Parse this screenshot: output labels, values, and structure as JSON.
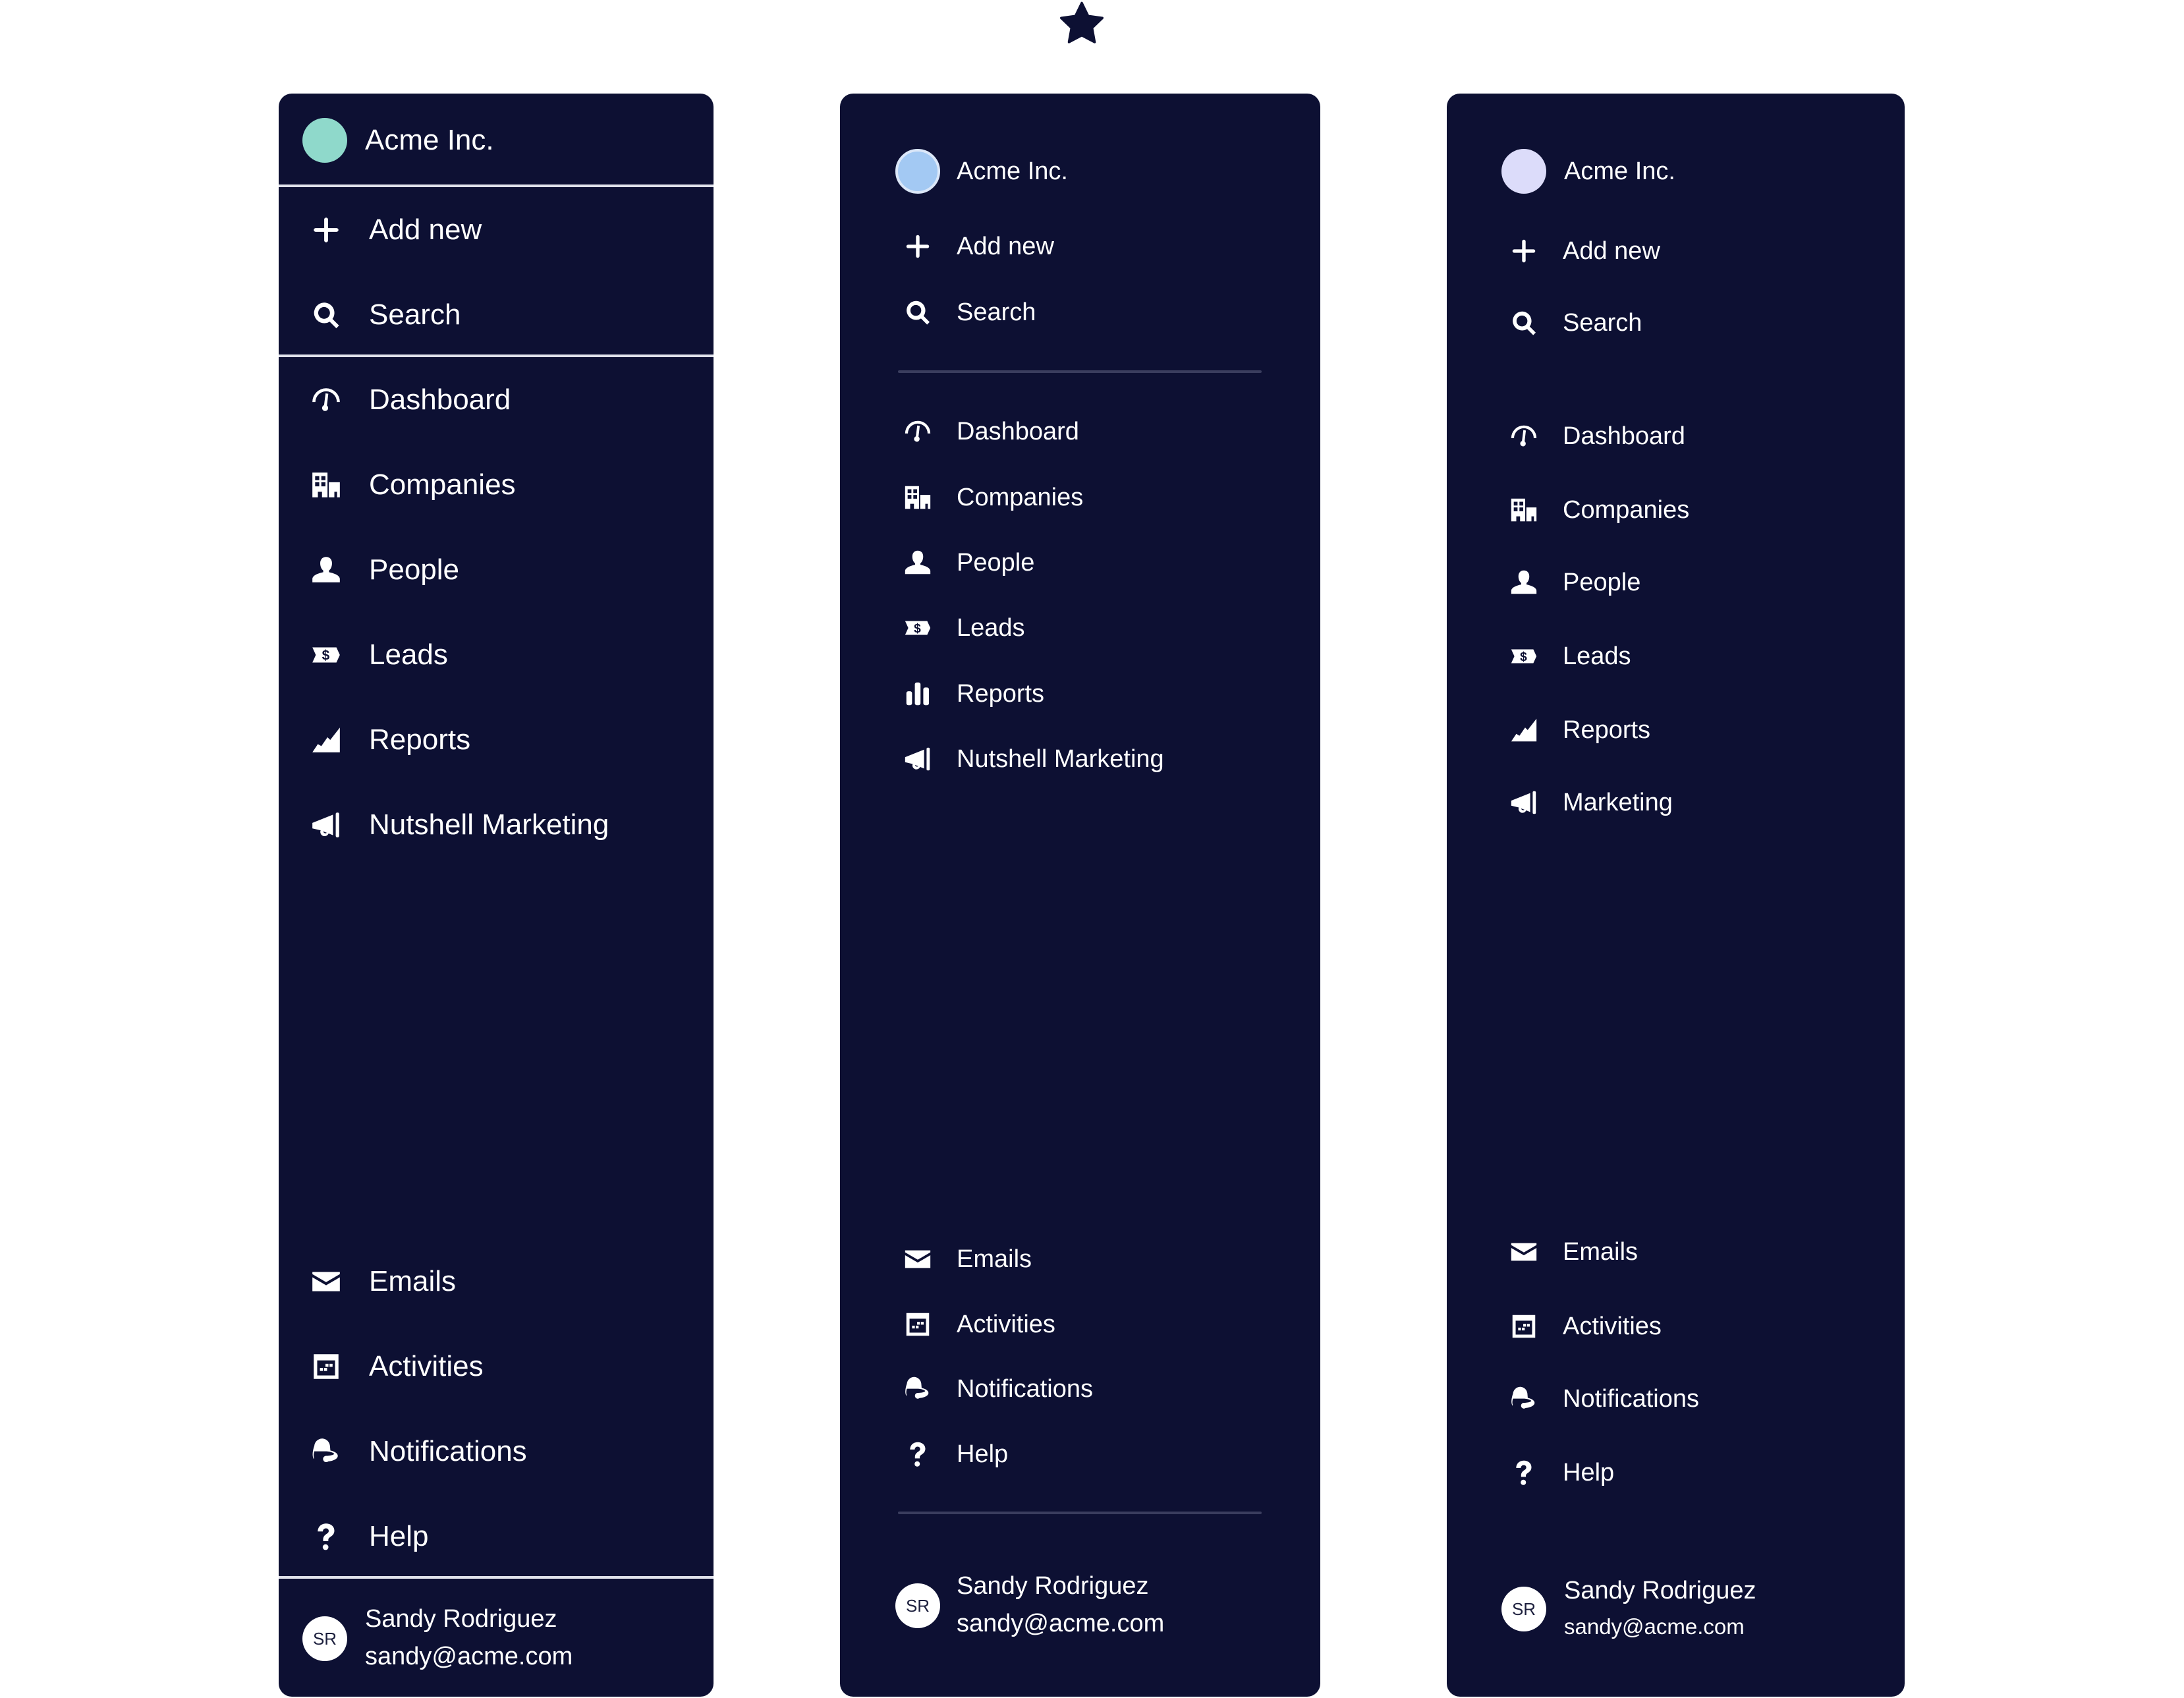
{
  "colors": {
    "page_background": "#ffffff",
    "panel_background": "#0d1033",
    "text": "#ffffff",
    "star": "#0d1033"
  },
  "top_icon": "star-icon",
  "panels": [
    {
      "variant": "A",
      "org": {
        "name": "Acme Inc.",
        "dot_color": "#8fd9cb"
      },
      "actions": [
        {
          "label": "Add new",
          "icon": "plus-icon"
        },
        {
          "label": "Search",
          "icon": "search-icon"
        }
      ],
      "nav": [
        {
          "label": "Dashboard",
          "icon": "gauge-icon"
        },
        {
          "label": "Companies",
          "icon": "building-icon"
        },
        {
          "label": "People",
          "icon": "person-icon"
        },
        {
          "label": "Leads",
          "icon": "dollar-tag-icon"
        },
        {
          "label": "Reports",
          "icon": "area-chart-icon"
        },
        {
          "label": "Nutshell Marketing",
          "icon": "megaphone-icon"
        }
      ],
      "bottom": [
        {
          "label": "Emails",
          "icon": "envelope-icon"
        },
        {
          "label": "Activities",
          "icon": "calendar-icon"
        },
        {
          "label": "Notifications",
          "icon": "bell-icon"
        },
        {
          "label": "Help",
          "icon": "question-icon"
        }
      ],
      "user": {
        "initials": "SR",
        "name": "Sandy Rodriguez",
        "email": "sandy@acme.com"
      }
    },
    {
      "variant": "B",
      "org": {
        "name": "Acme Inc.",
        "dot_color": "#a3c9f3"
      },
      "actions": [
        {
          "label": "Add new",
          "icon": "plus-icon"
        },
        {
          "label": "Search",
          "icon": "search-icon"
        }
      ],
      "nav": [
        {
          "label": "Dashboard",
          "icon": "gauge-icon"
        },
        {
          "label": "Companies",
          "icon": "building-icon"
        },
        {
          "label": "People",
          "icon": "person-icon"
        },
        {
          "label": "Leads",
          "icon": "dollar-tag-icon"
        },
        {
          "label": "Reports",
          "icon": "bar-chart-icon"
        },
        {
          "label": "Nutshell Marketing",
          "icon": "megaphone-icon"
        }
      ],
      "bottom": [
        {
          "label": "Emails",
          "icon": "envelope-icon"
        },
        {
          "label": "Activities",
          "icon": "calendar-icon"
        },
        {
          "label": "Notifications",
          "icon": "bell-icon"
        },
        {
          "label": "Help",
          "icon": "question-icon"
        }
      ],
      "user": {
        "initials": "SR",
        "name": "Sandy Rodriguez",
        "email": "sandy@acme.com"
      }
    },
    {
      "variant": "C",
      "org": {
        "name": "Acme Inc.",
        "dot_color": "#dcdcfa"
      },
      "actions": [
        {
          "label": "Add new",
          "icon": "plus-icon"
        },
        {
          "label": "Search",
          "icon": "search-icon"
        }
      ],
      "nav": [
        {
          "label": "Dashboard",
          "icon": "gauge-icon"
        },
        {
          "label": "Companies",
          "icon": "building-icon"
        },
        {
          "label": "People",
          "icon": "person-icon"
        },
        {
          "label": "Leads",
          "icon": "dollar-tag-icon"
        },
        {
          "label": "Reports",
          "icon": "area-chart-icon"
        },
        {
          "label": "Marketing",
          "icon": "megaphone-icon"
        }
      ],
      "bottom": [
        {
          "label": "Emails",
          "icon": "envelope-icon"
        },
        {
          "label": "Activities",
          "icon": "calendar-icon"
        },
        {
          "label": "Notifications",
          "icon": "bell-icon"
        },
        {
          "label": "Help",
          "icon": "question-icon"
        }
      ],
      "user": {
        "initials": "SR",
        "name": "Sandy Rodriguez",
        "email": "sandy@acme.com"
      }
    }
  ]
}
